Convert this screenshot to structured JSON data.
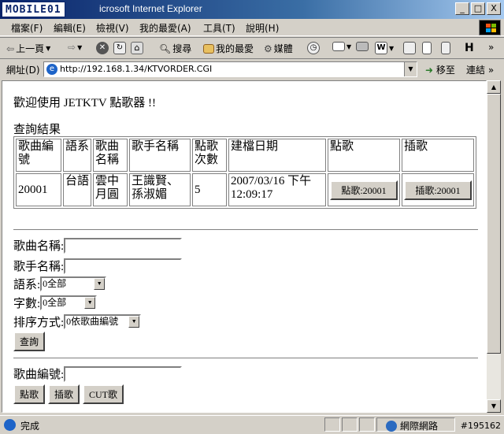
{
  "window": {
    "logo": "MOBILE01",
    "title": "icrosoft Internet Explorer",
    "minimize": "_",
    "maximize": "□",
    "close": "X"
  },
  "menu": [
    "檔案(F)",
    "編輯(E)",
    "檢視(V)",
    "我的最愛(A)",
    "工具(T)",
    "說明(H)"
  ],
  "toolbar": {
    "back": "上一頁",
    "search": "搜尋",
    "favorites": "我的最愛",
    "media": "媒體"
  },
  "address": {
    "label": "網址(D)",
    "url": "http://192.168.1.34/KTVORDER.CGI",
    "go": "移至",
    "links": "連結"
  },
  "page": {
    "welcome": "歡迎使用 JETKTV 點歌器 !!",
    "result_title": "查詢結果",
    "table": {
      "headers": [
        "歌曲編號",
        "語系",
        "歌曲名稱",
        "歌手名稱",
        "點歌次數",
        "建檔日期",
        "點歌",
        "插歌"
      ],
      "rows": [
        {
          "song_no": "20001",
          "lang": "台語",
          "song_name": "雲中月圓",
          "singer": "王識賢、孫淑媚",
          "count": "5",
          "date": "2007/03/16 下午 12:09:17",
          "order_btn": "點歌:20001",
          "insert_btn": "插歌:20001"
        }
      ]
    },
    "search_form": {
      "song_name_label": "歌曲名稱:",
      "singer_label": "歌手名稱:",
      "lang_label": "語系:",
      "lang_value": "0全部",
      "length_label": "字數:",
      "length_value": "0全部",
      "sort_label": "排序方式:",
      "sort_value": "0依歌曲編號",
      "query_btn": "查詢"
    },
    "order_form": {
      "song_no_label": "歌曲編號:",
      "order_btn": "點歌",
      "insert_btn": "插歌",
      "cut_btn": "CUT歌"
    }
  },
  "status": {
    "text": "完成",
    "zone": "網際網路",
    "watermark": "#195162"
  }
}
